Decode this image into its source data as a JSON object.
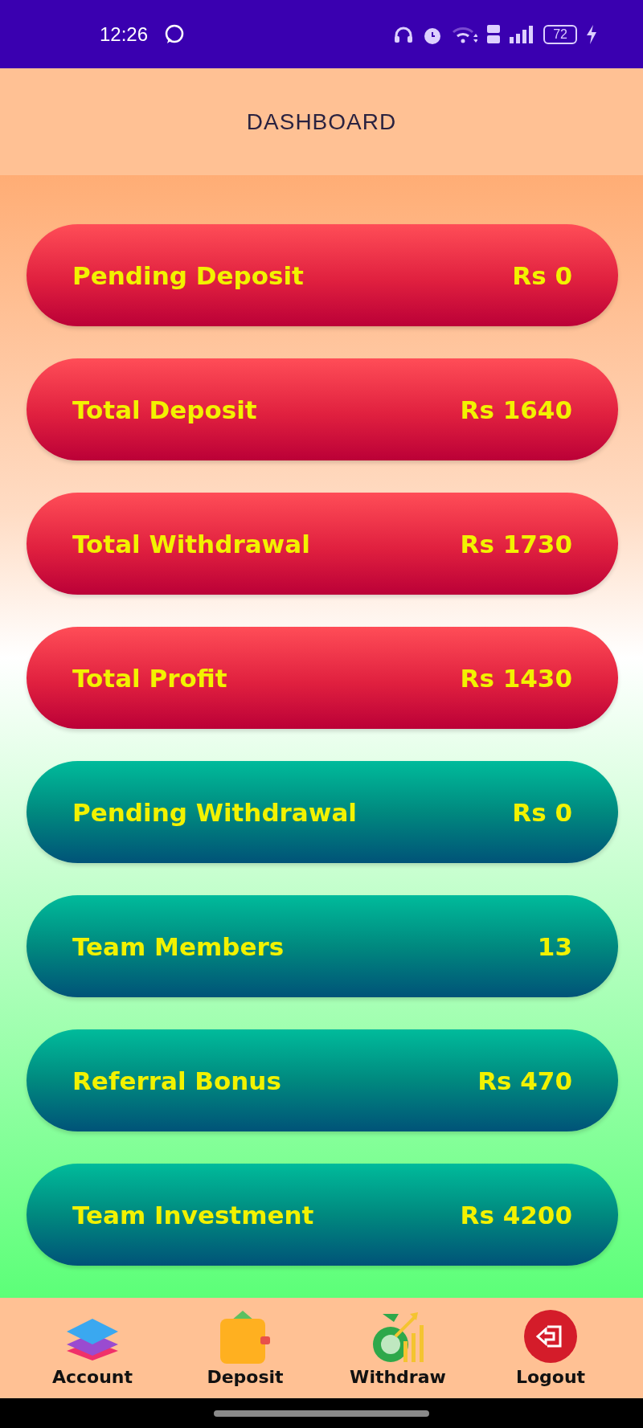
{
  "status_bar": {
    "time": "12:26",
    "battery": "72"
  },
  "header": {
    "title": "DASHBOARD"
  },
  "cards": [
    {
      "label": "Pending Deposit",
      "value": "Rs 0",
      "kind": "red"
    },
    {
      "label": "Total Deposit",
      "value": "Rs 1640",
      "kind": "red"
    },
    {
      "label": "Total Withdrawal",
      "value": "Rs 1730",
      "kind": "red"
    },
    {
      "label": "Total Profit",
      "value": "Rs 1430",
      "kind": "red"
    },
    {
      "label": "Pending Withdrawal",
      "value": "Rs 0",
      "kind": "teal"
    },
    {
      "label": "Team Members",
      "value": "13",
      "kind": "teal"
    },
    {
      "label": "Referral Bonus",
      "value": "Rs 470",
      "kind": "teal"
    },
    {
      "label": "Team Investment",
      "value": "Rs 4200",
      "kind": "teal"
    }
  ],
  "bottom_nav": [
    {
      "label": "Account",
      "kind": "layers"
    },
    {
      "label": "Deposit",
      "kind": "wallet"
    },
    {
      "label": "Withdraw",
      "kind": "money"
    },
    {
      "label": "Logout",
      "kind": "logout"
    }
  ]
}
